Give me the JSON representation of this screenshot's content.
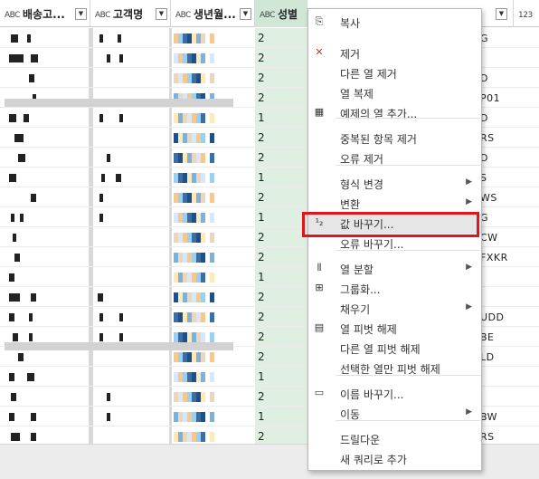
{
  "columns": [
    {
      "type": "ABC",
      "label": "배송고..."
    },
    {
      "type": "ABC",
      "label": "고객명"
    },
    {
      "type": "ABC",
      "label": "생년월..."
    },
    {
      "type": "ABC",
      "label": "성별"
    },
    {
      "type": "123",
      "label": ""
    }
  ],
  "gender_values": [
    "2",
    "2",
    "2",
    "2",
    "1",
    "2",
    "2",
    "1",
    "2",
    "1",
    "2",
    "2",
    "1",
    "2",
    "2",
    "2",
    "2",
    "1",
    "2",
    "1",
    "2",
    "1"
  ],
  "right_values": [
    "G",
    "",
    "D",
    "P01",
    "D",
    "RS",
    "D",
    "S",
    "WS",
    "G",
    "CW",
    "FXKR",
    "",
    "",
    "UDD",
    "BE",
    "LD",
    "",
    "",
    "BW",
    "RS",
    "D"
  ],
  "context_menu": {
    "items": [
      {
        "icon": "copy-icon",
        "label": "복사"
      },
      {
        "icon": "remove-icon",
        "label": "제거"
      },
      {
        "icon": "",
        "label": "다른 열 제거"
      },
      {
        "icon": "",
        "label": "열 복제"
      },
      {
        "icon": "column-from-examples-icon",
        "label": "예제의 열 추가..."
      },
      {
        "icon": "",
        "label": "중복된 항목 제거"
      },
      {
        "icon": "",
        "label": "오류 제거"
      },
      {
        "icon": "",
        "label": "형식 변경",
        "submenu": true
      },
      {
        "icon": "",
        "label": "변환",
        "submenu": true
      },
      {
        "icon": "replace-values-icon",
        "label": "값 바꾸기..."
      },
      {
        "icon": "",
        "label": "오류 바꾸기..."
      },
      {
        "icon": "split-column-icon",
        "label": "열 분할",
        "submenu": true
      },
      {
        "icon": "group-by-icon",
        "label": "그룹화..."
      },
      {
        "icon": "",
        "label": "채우기",
        "submenu": true
      },
      {
        "icon": "unpivot-icon",
        "label": "열 피벗 해제"
      },
      {
        "icon": "",
        "label": "다른 열 피벗 해제"
      },
      {
        "icon": "",
        "label": "선택한 열만 피벗 해제"
      },
      {
        "icon": "rename-icon",
        "label": "이름 바꾸기..."
      },
      {
        "icon": "",
        "label": "이동",
        "submenu": true
      },
      {
        "icon": "",
        "label": "드릴다운"
      },
      {
        "icon": "",
        "label": "새 쿼리로 추가"
      }
    ]
  },
  "colors": {
    "selected_column": "#dff0e3",
    "highlight_box": "#e3141b"
  }
}
